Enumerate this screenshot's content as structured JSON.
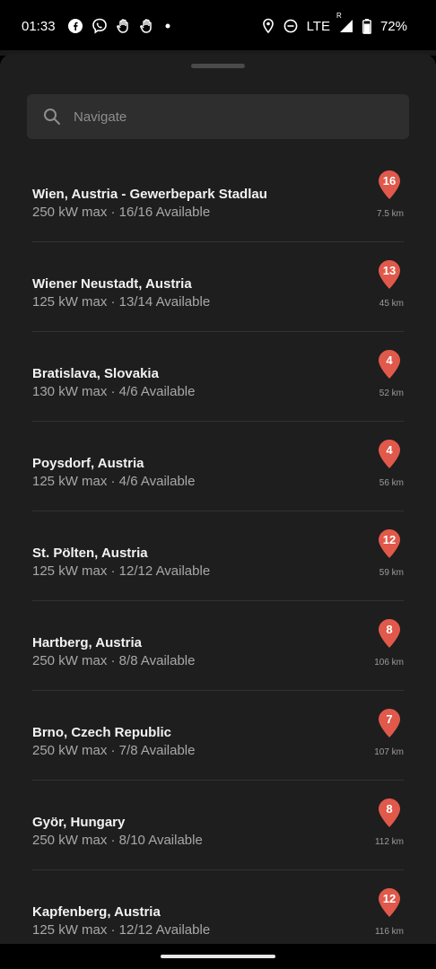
{
  "status_bar": {
    "time": "01:33",
    "network": "LTE",
    "roaming": "R",
    "battery": "72%",
    "notification_icons": [
      "facebook-icon",
      "viber-icon",
      "hand-wave-icon",
      "hand-wave-icon",
      "dot-icon"
    ]
  },
  "search": {
    "placeholder": "Navigate"
  },
  "colors": {
    "background": "#1e1e1e",
    "pin": "#e0594a",
    "search_bg": "#2e2e2e",
    "divider": "#323232"
  },
  "chargers": [
    {
      "name": "Wien, Austria - Gewerbepark Stadlau",
      "details": "250 kW max · 16/16 Available",
      "count": "16",
      "distance": "7.5 km"
    },
    {
      "name": "Wiener Neustadt, Austria",
      "details": "125 kW max · 13/14 Available",
      "count": "13",
      "distance": "45 km"
    },
    {
      "name": "Bratislava, Slovakia",
      "details": "130 kW max · 4/6 Available",
      "count": "4",
      "distance": "52 km"
    },
    {
      "name": "Poysdorf, Austria",
      "details": "125 kW max · 4/6 Available",
      "count": "4",
      "distance": "56 km"
    },
    {
      "name": "St. Pölten, Austria",
      "details": "125 kW max · 12/12 Available",
      "count": "12",
      "distance": "59 km"
    },
    {
      "name": "Hartberg, Austria",
      "details": "250 kW max · 8/8 Available",
      "count": "8",
      "distance": "106 km"
    },
    {
      "name": "Brno, Czech Republic",
      "details": "250 kW max · 7/8 Available",
      "count": "7",
      "distance": "107 km"
    },
    {
      "name": "Györ, Hungary",
      "details": "250 kW max · 8/10 Available",
      "count": "8",
      "distance": "112 km"
    },
    {
      "name": "Kapfenberg, Austria",
      "details": "125 kW max · 12/12 Available",
      "count": "12",
      "distance": "116 km"
    }
  ]
}
